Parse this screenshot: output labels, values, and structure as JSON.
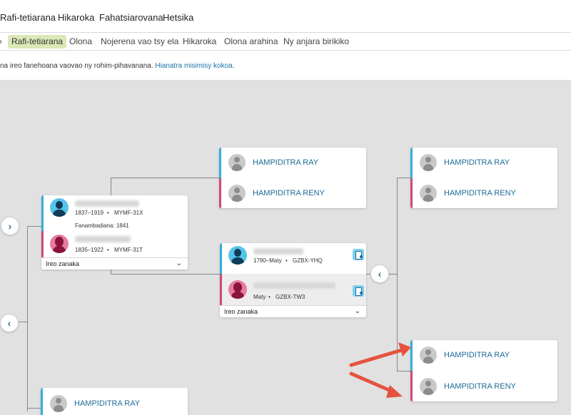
{
  "topnav": {
    "items": [
      "Rafi-tetiarana",
      "Hikaroka",
      "Fahatsiarovana",
      "Hetsika"
    ]
  },
  "subnav": {
    "lead": "›",
    "items": [
      "Rafi-tetiarana",
      "Olona",
      "Nojerena vao tsy ela",
      "Hikaroka",
      "Olona arahina",
      "Ny anjara birikiko"
    ],
    "active_index": 0
  },
  "notice": {
    "text": "na ireo fanehoana vaovao ny rohim-pihavanana. ",
    "link": "Hianatra misimisy kokoa."
  },
  "tree": {
    "left_couple": {
      "husband_dates": "1837–1919",
      "husband_id": "MYMF-31X",
      "marriage": "Fanambadiana: 1841",
      "wife_dates": "1835–1922",
      "wife_id": "MYMF-31T",
      "children_label": "Ireo zanaka"
    },
    "center_couple": {
      "husband_dates": "1790–Maty",
      "husband_id": "GZBX-YHQ",
      "wife_dates": "Maty",
      "wife_id": "GZBX-TW3",
      "children_label": "Ireo zanaka"
    },
    "upper_parents": {
      "father": "HAMPIDITRA RAY",
      "mother": "HAMPIDITRA RENY"
    },
    "right_upper_parents": {
      "father": "HAMPIDITRA RAY",
      "mother": "HAMPIDITRA RENY"
    },
    "right_lower_parents": {
      "father": "HAMPIDITRA RAY",
      "mother": "HAMPIDITRA RENY"
    },
    "bottom_parent": {
      "father": "HAMPIDITRA RAY"
    },
    "separator": "•"
  },
  "colors": {
    "male_border": "#35aed9",
    "female_border": "#d04a7a",
    "link": "#1d6a96",
    "active_tab": "#dbe8b7",
    "arrow": "#e5533f"
  },
  "icons": [
    "chevron-right-icon",
    "chevron-left-icon",
    "chevron-down-icon",
    "person-placeholder-icon",
    "male-avatar-icon",
    "female-avatar-icon",
    "record-task-icon",
    "annotation-arrow-icon"
  ]
}
